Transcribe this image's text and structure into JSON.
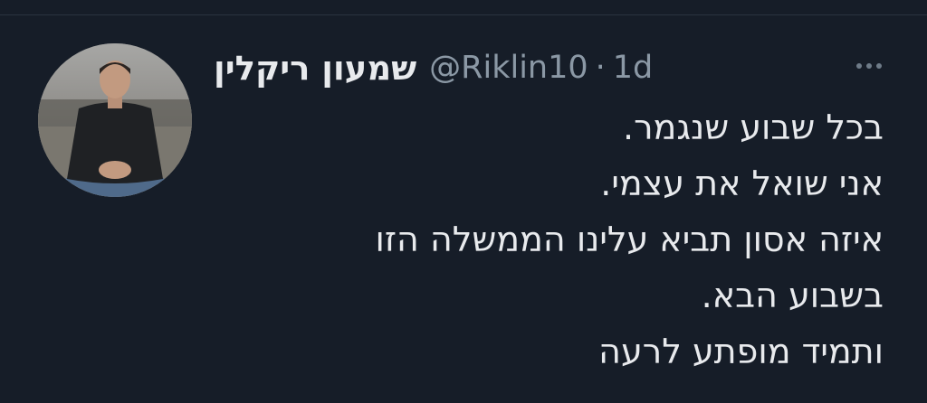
{
  "tweet": {
    "author": {
      "display_name": "שמעון ריקלין",
      "handle": "@Riklin10",
      "avatar_icon": "profile-photo"
    },
    "separator": "·",
    "time": "1d",
    "more_icon": "ellipsis-icon",
    "lines": [
      "בכל שבוע שנגמר.",
      "אני שואל את עצמי.",
      "איזה אסון תביא עלינו הממשלה הזו",
      "בשבוע הבא.",
      "ותמיד מופתע לרעה"
    ]
  },
  "colors": {
    "background": "#161d28",
    "primary_text": "#e8eaed",
    "secondary_text": "#8b98a5"
  }
}
